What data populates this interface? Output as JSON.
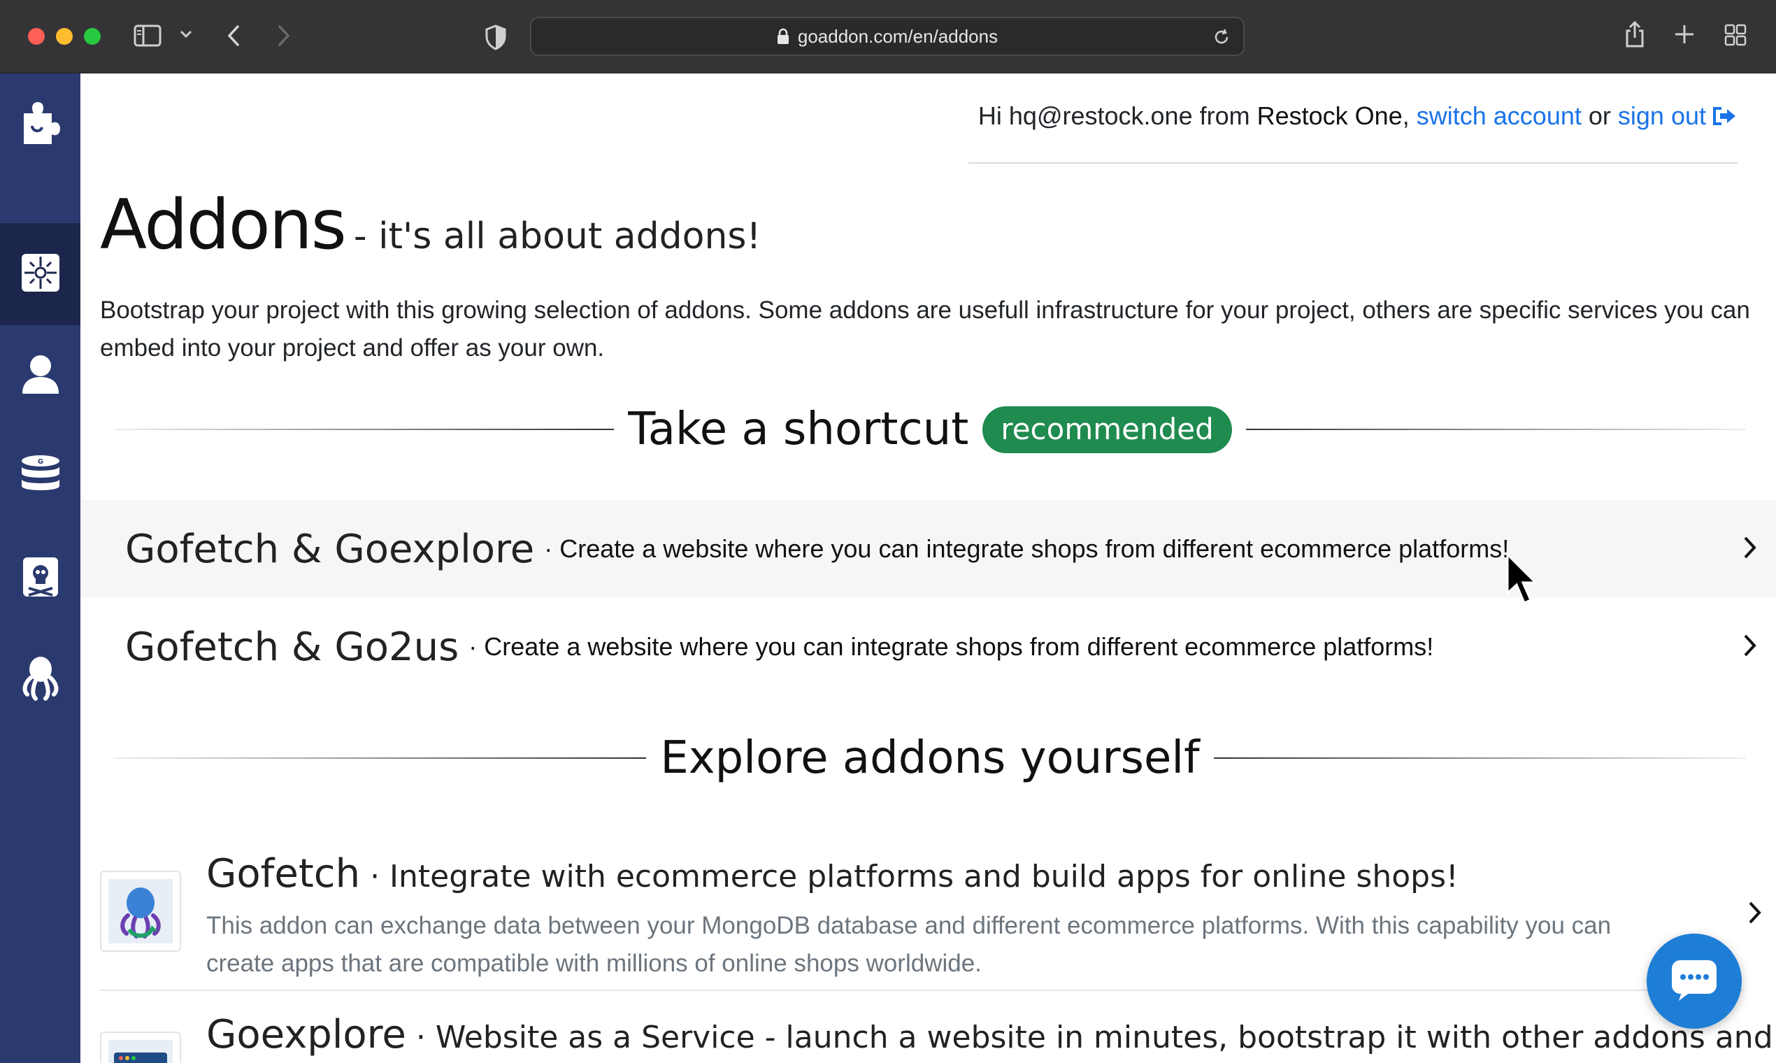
{
  "browser": {
    "url": "goaddon.com/en/addons"
  },
  "sidebar": {
    "items": [
      {
        "icon": "puzzle-icon"
      },
      {
        "icon": "puzzle-grid-icon",
        "active": true
      },
      {
        "icon": "user-icon"
      },
      {
        "icon": "database-icon"
      },
      {
        "icon": "pirate-icon"
      },
      {
        "icon": "octopus-icon"
      }
    ]
  },
  "greeting": {
    "hi": "Hi",
    "email": "hq@restock.one",
    "from": "from",
    "org": "Restock One",
    "comma": ",",
    "switch_account": "switch account",
    "or": "or",
    "sign_out": "sign out"
  },
  "page": {
    "title": "Addons",
    "subtitle": "- it's all about addons!",
    "intro": "Bootstrap your project with this growing selection of addons. Some addons are usefull infrastructure for your project, others are specific services you can embed into your project and offer as your own."
  },
  "shortcut_section": {
    "heading": "Take a shortcut",
    "badge": "recommended",
    "items": [
      {
        "name": "Gofetch & Goexplore",
        "desc": "· Create a website where you can integrate shops from different ecommerce platforms!"
      },
      {
        "name": "Gofetch & Go2us",
        "desc": "· Create a website where you can integrate shops from different ecommerce platforms!"
      }
    ]
  },
  "explore_section": {
    "heading": "Explore addons yourself",
    "addons": [
      {
        "name": "Gofetch",
        "tagline": "· Integrate with ecommerce platforms and build apps for online shops!",
        "desc": "This addon can exchange data between your MongoDB database and different ecommerce platforms. With this capability you can create apps that are compatible with millions of online shops worldwide."
      },
      {
        "name": "Goexplore",
        "tagline": "· Website as a Service - launch a website in minutes, bootstrap it with other addons and",
        "desc": ""
      }
    ]
  },
  "colors": {
    "sidebar": "#2b3a6e",
    "sidebar_active": "#1c264d",
    "badge": "#1f8b4f",
    "link": "#1a73e8",
    "chat": "#1e7ed6"
  }
}
